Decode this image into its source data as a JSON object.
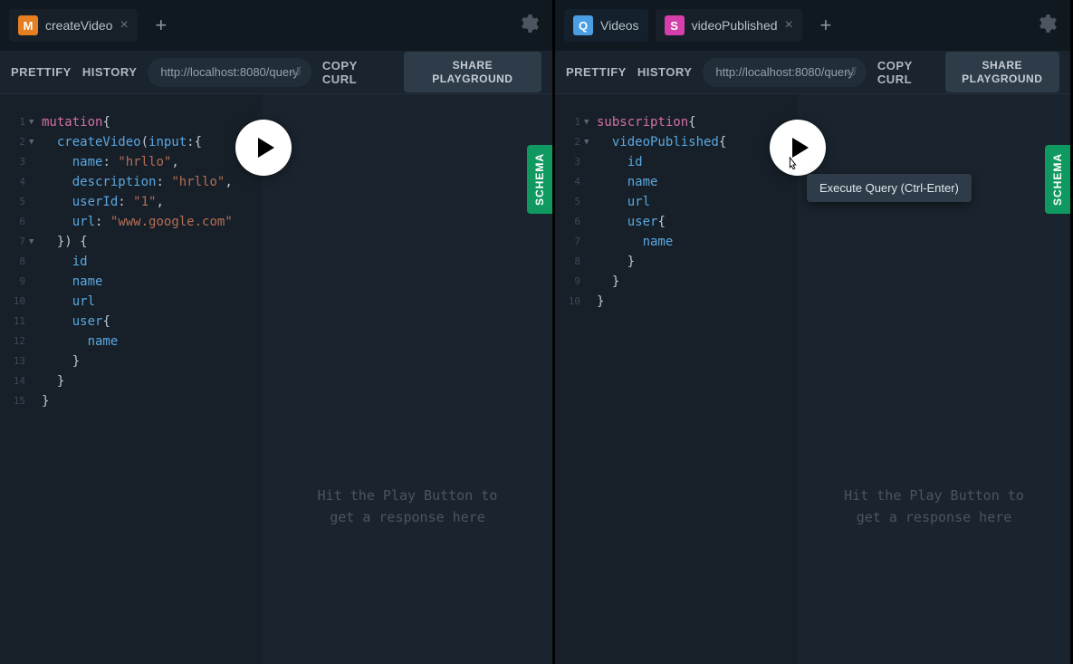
{
  "left": {
    "tabs": [
      {
        "badge": "M",
        "label": "createVideo"
      }
    ],
    "toolbar": {
      "prettify": "PRETTIFY",
      "history": "HISTORY",
      "endpoint": "http://localhost:8080/query",
      "copy_curl": "COPY CURL",
      "share": "SHARE PLAYGROUND"
    },
    "code": {
      "l1_kw": "mutation",
      "l1_brace": "{",
      "l2_fn": "createVideo",
      "l2_open": "(",
      "l2_arg": "input",
      "l2_colon": ":",
      "l2_brace": "{",
      "l3_field": "name",
      "l3_colon": ":",
      "l3_val": "\"hrllo\"",
      "l3_comma": ",",
      "l4_field": "description",
      "l4_colon": ":",
      "l4_val": "\"hrllo\"",
      "l4_comma": ",",
      "l5_field": "userId",
      "l5_colon": ":",
      "l5_val": "\"1\"",
      "l5_comma": ",",
      "l6_field": "url",
      "l6_colon": ":",
      "l6_val": "\"www.google.com\"",
      "l7": "}) {",
      "l8": "id",
      "l9": "name",
      "l10": "url",
      "l11_field": "user",
      "l11_brace": "{",
      "l12": "name",
      "l13": "}",
      "l14": "}",
      "l15": "}"
    },
    "placeholder_line1": "Hit the Play Button to",
    "placeholder_line2": "get a response here",
    "schema": "SCHEMA"
  },
  "right": {
    "tabs": [
      {
        "badge": "Q",
        "label": "Videos"
      },
      {
        "badge": "S",
        "label": "videoPublished"
      }
    ],
    "toolbar": {
      "prettify": "PRETTIFY",
      "history": "HISTORY",
      "endpoint": "http://localhost:8080/query",
      "copy_curl": "COPY CURL",
      "share": "SHARE PLAYGROUND"
    },
    "code": {
      "l1_kw": "subscription",
      "l1_brace": "{",
      "l2_fn": "videoPublished",
      "l2_brace": "{",
      "l3": "id",
      "l4": "name",
      "l5": "url",
      "l6_field": "user",
      "l6_brace": "{",
      "l7": "name",
      "l8": "}",
      "l9": "}",
      "l10": "}"
    },
    "placeholder_line1": "Hit the Play Button to",
    "placeholder_line2": "get a response here",
    "schema": "SCHEMA",
    "tooltip": "Execute Query (Ctrl-Enter)"
  }
}
